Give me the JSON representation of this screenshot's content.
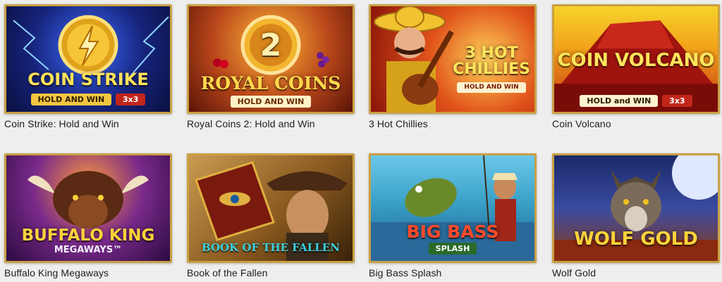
{
  "games": [
    {
      "name": "Coin Strike: Hold and Win",
      "art_title": "COIN STRIKE",
      "art_sub": "HOLD AND WIN",
      "art_badge": "3x3",
      "icon": "lightning-coin-icon"
    },
    {
      "name": "Royal Coins 2: Hold and Win",
      "art_title": "ROYAL COINS",
      "art_sub": "HOLD AND WIN",
      "art_badge": "2",
      "icon": "coin-2-icon"
    },
    {
      "name": "3 Hot Chillies",
      "art_title": "3 HOT CHILLIES",
      "art_sub": "HOLD AND WIN",
      "art_badge": "",
      "icon": "mariachi-guitar-icon"
    },
    {
      "name": "Coin Volcano",
      "art_title": "COIN VOLCANO",
      "art_sub": "HOLD and WIN",
      "art_badge": "3x3",
      "icon": "volcano-icon"
    },
    {
      "name": "Buffalo King Megaways",
      "art_title": "BUFFALO KING",
      "art_sub": "MEGAWAYS™",
      "art_badge": "",
      "icon": "buffalo-icon"
    },
    {
      "name": "Book of the Fallen",
      "art_title": "BOOK OF THE FALLEN",
      "art_sub": "",
      "art_badge": "",
      "icon": "book-eye-icon"
    },
    {
      "name": "Big Bass Splash",
      "art_title": "BIG BASS",
      "art_sub": "SPLASH",
      "art_badge": "",
      "icon": "fish-icon"
    },
    {
      "name": "Wolf Gold",
      "art_title": "WOLF GOLD",
      "art_sub": "",
      "art_badge": "",
      "icon": "wolf-icon"
    }
  ],
  "colors": {
    "frame": "#c9a043",
    "caption": "#1d1d1d",
    "background": "#eeeeee"
  }
}
